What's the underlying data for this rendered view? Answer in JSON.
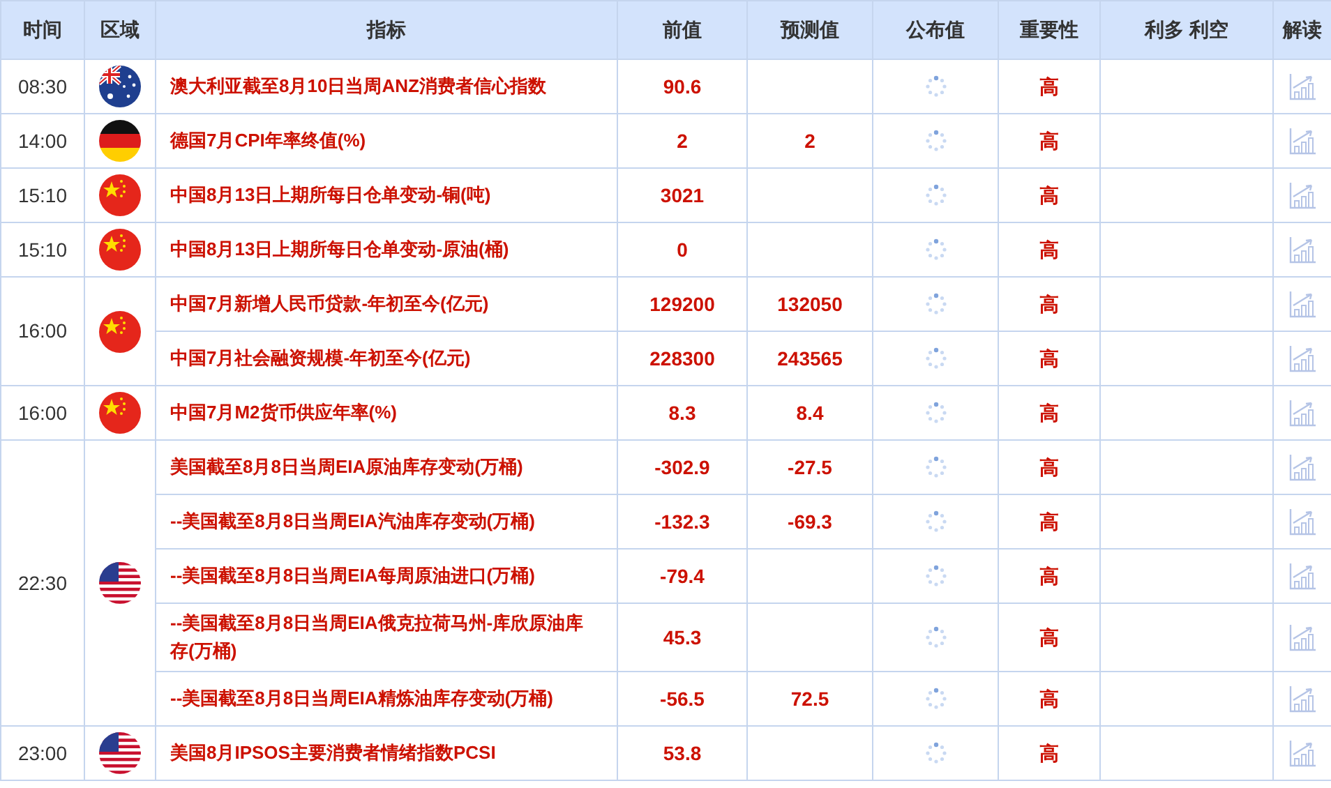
{
  "columns": [
    "时间",
    "区域",
    "指标",
    "前值",
    "预测值",
    "公布值",
    "重要性",
    "利多 利空",
    "解读"
  ],
  "groups": [
    {
      "time": "08:30",
      "kind": "au",
      "rows": [
        {
          "name": "澳大利亚截至8月10日当周ANZ消费者信心指数",
          "previous": "90.6",
          "forecast": "",
          "importance": "高"
        }
      ]
    },
    {
      "time": "14:00",
      "kind": "de",
      "rows": [
        {
          "name": "德国7月CPI年率终值(%)",
          "previous": "2",
          "forecast": "2",
          "importance": "高"
        }
      ]
    },
    {
      "time": "15:10",
      "kind": "cn",
      "rows": [
        {
          "name": "中国8月13日上期所每日仓单变动-铜(吨)",
          "previous": "3021",
          "forecast": "",
          "importance": "高"
        }
      ]
    },
    {
      "time": "15:10",
      "kind": "cn",
      "rows": [
        {
          "name": "中国8月13日上期所每日仓单变动-原油(桶)",
          "previous": "0",
          "forecast": "",
          "importance": "高"
        }
      ]
    },
    {
      "time": "16:00",
      "kind": "cn",
      "rows": [
        {
          "name": "中国7月新增人民币贷款-年初至今(亿元)",
          "previous": "129200",
          "forecast": "132050",
          "importance": "高"
        },
        {
          "name": "中国7月社会融资规模-年初至今(亿元)",
          "previous": "228300",
          "forecast": "243565",
          "importance": "高"
        }
      ]
    },
    {
      "time": "16:00",
      "kind": "cn",
      "rows": [
        {
          "name": "中国7月M2货币供应年率(%)",
          "previous": "8.3",
          "forecast": "8.4",
          "importance": "高"
        }
      ]
    },
    {
      "time": "22:30",
      "kind": "us",
      "rows": [
        {
          "name": "美国截至8月8日当周EIA原油库存变动(万桶)",
          "previous": "-302.9",
          "forecast": "-27.5",
          "importance": "高"
        },
        {
          "name": "--美国截至8月8日当周EIA汽油库存变动(万桶)",
          "previous": "-132.3",
          "forecast": "-69.3",
          "importance": "高"
        },
        {
          "name": "--美国截至8月8日当周EIA每周原油进口(万桶)",
          "previous": "-79.4",
          "forecast": "",
          "importance": "高"
        },
        {
          "name": "--美国截至8月8日当周EIA俄克拉荷马州-库欣原油库存(万桶)",
          "previous": "45.3",
          "forecast": "",
          "importance": "高"
        },
        {
          "name": "--美国截至8月8日当周EIA精炼油库存变动(万桶)",
          "previous": "-56.5",
          "forecast": "72.5",
          "importance": "高"
        }
      ]
    },
    {
      "time": "23:00",
      "kind": "us",
      "rows": [
        {
          "name": "美国8月IPSOS主要消费者情绪指数PCSI",
          "previous": "53.8",
          "forecast": "",
          "importance": "高"
        }
      ]
    }
  ]
}
